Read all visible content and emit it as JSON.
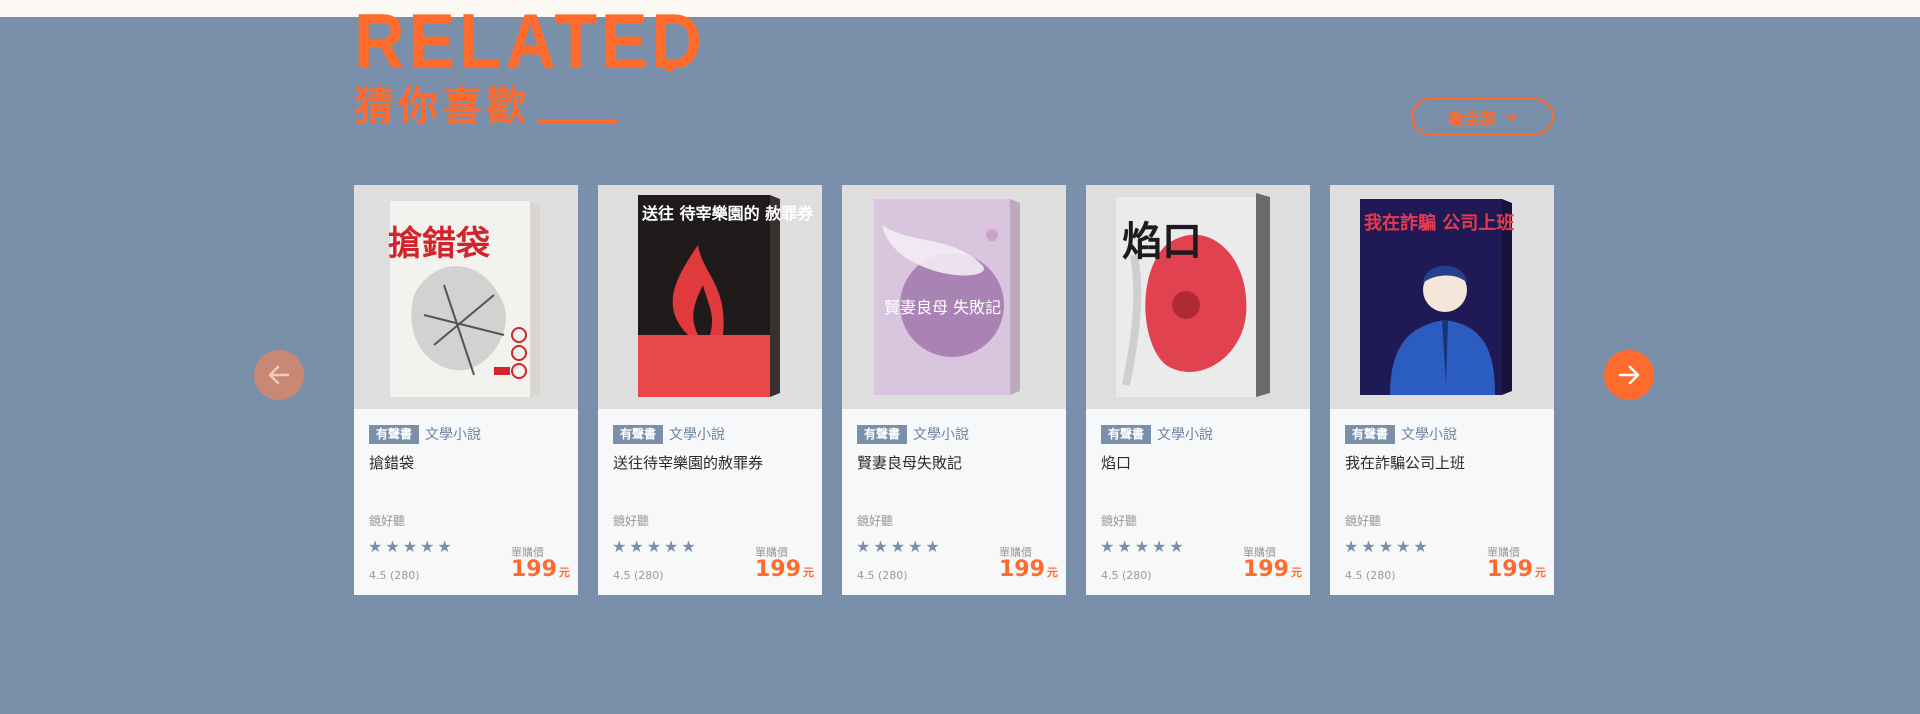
{
  "section": {
    "heading_en": "RELATED",
    "heading_zh": "猜你喜歡",
    "view_all": "看全部"
  },
  "colors": {
    "accent": "#ff6b2c",
    "background": "#7a8fa9",
    "badge": "#7a8fa9"
  },
  "books": [
    {
      "badge": "有聲書",
      "category": "文學小說",
      "title": "搶錯袋",
      "author": "鏡好聽",
      "rating": "4.5 (280)",
      "price_label": "單購價",
      "price": "199",
      "currency": "元",
      "stars": 5,
      "cover_text": "搶錯袋"
    },
    {
      "badge": "有聲書",
      "category": "文學小說",
      "title": "送往待宰樂園的赦罪券",
      "author": "鏡好聽",
      "rating": "4.5 (280)",
      "price_label": "單購價",
      "price": "199",
      "currency": "元",
      "stars": 5,
      "cover_text": "送往 待宰樂園的 赦罪券"
    },
    {
      "badge": "有聲書",
      "category": "文學小說",
      "title": "賢妻良母失敗記",
      "author": "鏡好聽",
      "rating": "4.5 (280)",
      "price_label": "單購價",
      "price": "199",
      "currency": "元",
      "stars": 5,
      "cover_text": "賢妻良母 失敗記"
    },
    {
      "badge": "有聲書",
      "category": "文學小說",
      "title": "焰口",
      "author": "鏡好聽",
      "rating": "4.5 (280)",
      "price_label": "單購價",
      "price": "199",
      "currency": "元",
      "stars": 5,
      "cover_text": "焰口"
    },
    {
      "badge": "有聲書",
      "category": "文學小說",
      "title": "我在詐騙公司上班",
      "author": "鏡好聽",
      "rating": "4.5 (280)",
      "price_label": "單購價",
      "price": "199",
      "currency": "元",
      "stars": 5,
      "cover_text": "我在詐騙 公司上班"
    }
  ],
  "nav": {
    "prev_icon": "arrow-left-icon",
    "next_icon": "arrow-right-icon"
  }
}
